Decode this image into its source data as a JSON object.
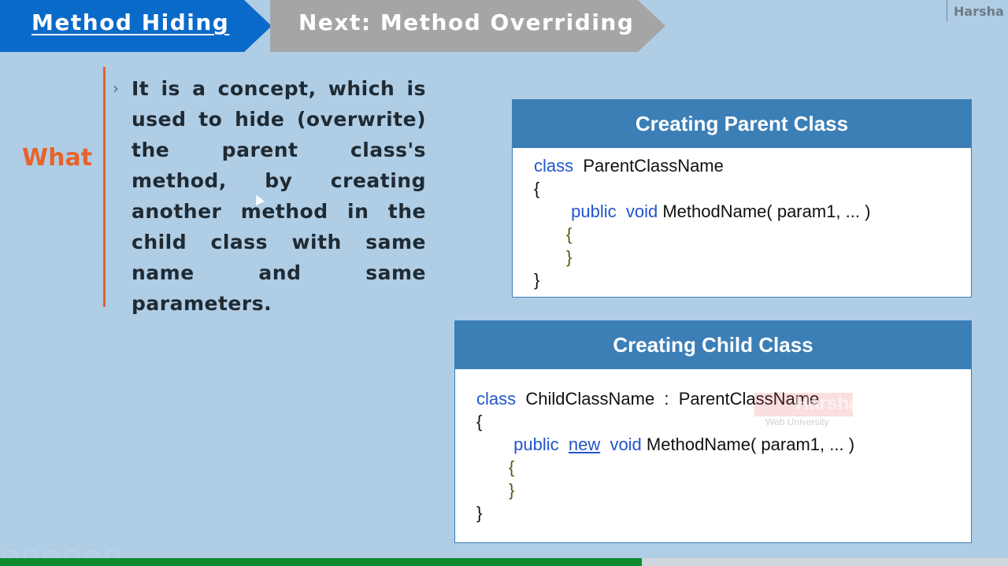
{
  "tabs": {
    "current": "Method Hiding",
    "next": "Next: Method Overriding"
  },
  "brand": "Harsha",
  "left_panel": {
    "label": "What",
    "description": "It is a concept, which is used to hide (overwrite) the parent class's method, by creating another method in the child class with same name and same parameters."
  },
  "parent_card": {
    "title": "Creating Parent Class",
    "kw_class": "class",
    "class_name": "ParentClassName",
    "open_brace": "{",
    "kw_public": "public",
    "kw_void": "void",
    "method_sig": "MethodName( param1, ... )",
    "inner_open": "{",
    "inner_close": "}",
    "close_brace": "}"
  },
  "child_card": {
    "title": "Creating Child Class",
    "kw_class": "class",
    "class_decl": "ChildClassName  :  ParentClassName",
    "open_brace": "{",
    "kw_public": "public",
    "kw_new": "new",
    "kw_void": "void",
    "method_sig": "MethodName( param1, ... )",
    "inner_open": "{",
    "inner_close": "}",
    "close_brace": "}"
  },
  "watermark": {
    "name": "Harsha",
    "sub": "Web University"
  },
  "player": {
    "progress": 0.637
  },
  "colors": {
    "background": "#afcde5",
    "tab_current": "#0a6ac9",
    "tab_next": "#a5a5a5",
    "accent_orange": "#e8632a",
    "card_header": "#3c7fb7",
    "keyword_blue": "#2255cc",
    "progress_green": "#0f8a2e"
  }
}
